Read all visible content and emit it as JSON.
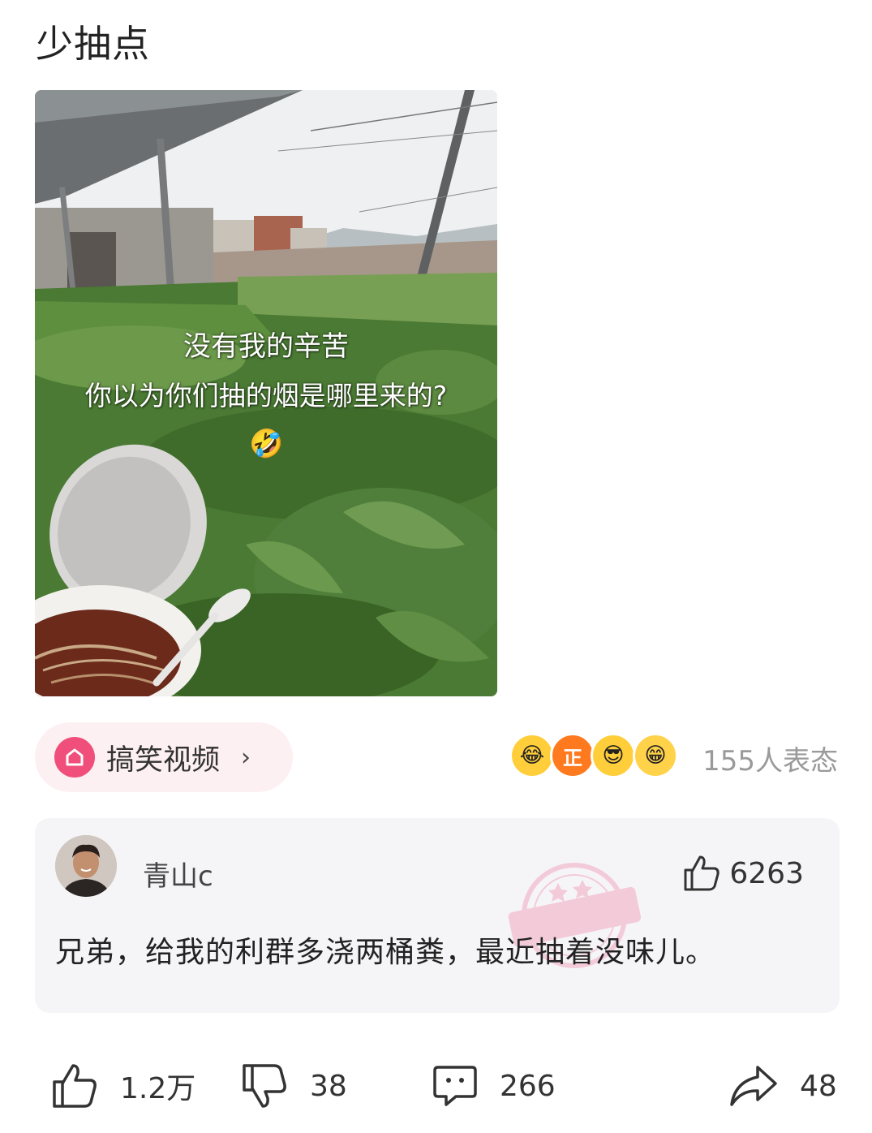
{
  "post": {
    "title": "少抽点",
    "image_overlay": {
      "line1": "没有我的辛苦",
      "line2": "你以为你们抽的烟是哪里来的?",
      "emoji": "🤣"
    }
  },
  "topic": {
    "icon": "topic-home-icon",
    "label": "搞笑视频",
    "chevron": "›",
    "accent": "#ef4f7a"
  },
  "reactions": {
    "emojis": [
      "😂",
      "正",
      "😎",
      "😁"
    ],
    "count_text": "155人表态"
  },
  "comment": {
    "username": "青山c",
    "likes": "6263",
    "text": "兄弟，给我的利群多浇两桶粪，最近抽着没味儿。",
    "watermark": "神评"
  },
  "actions": {
    "like": "1.2万",
    "dislike": "38",
    "comment": "266",
    "share": "48"
  }
}
